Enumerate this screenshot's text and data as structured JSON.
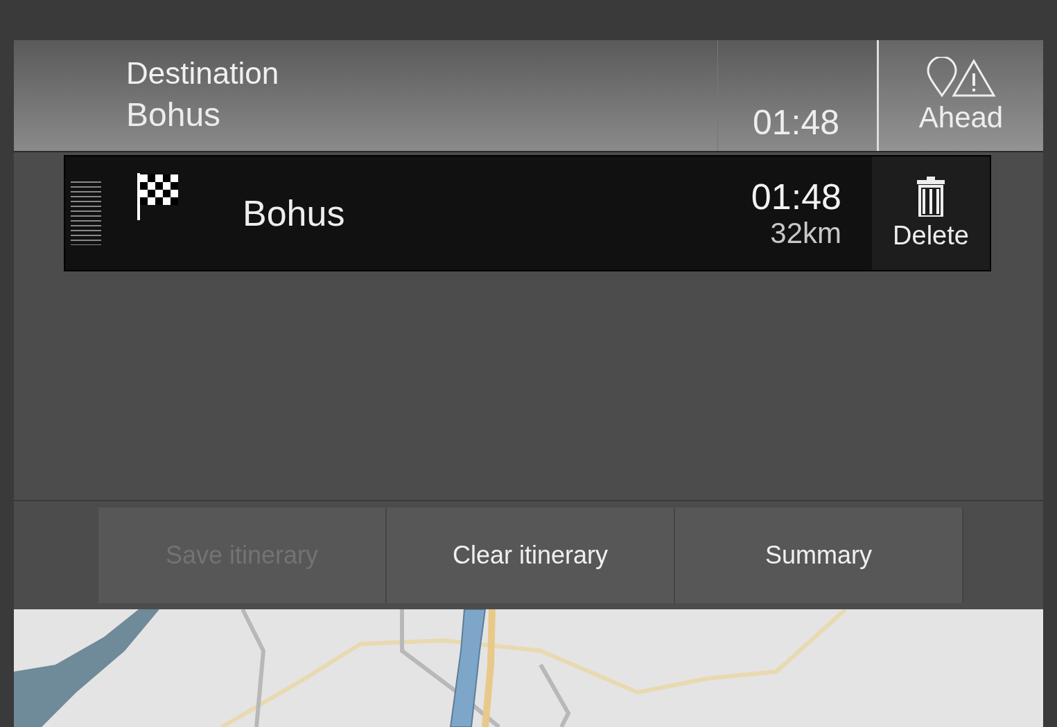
{
  "header": {
    "label": "Destination",
    "destination": "Bohus",
    "eta": "01:48",
    "ahead_button": "Ahead"
  },
  "itinerary": [
    {
      "name": "Bohus",
      "eta": "01:48",
      "distance": "32km",
      "delete_button": "Delete"
    }
  ],
  "actions": [
    {
      "label": "Save itinerary",
      "disabled": true
    },
    {
      "label": "Clear itinerary",
      "disabled": false
    },
    {
      "label": "Summary",
      "disabled": false
    }
  ]
}
